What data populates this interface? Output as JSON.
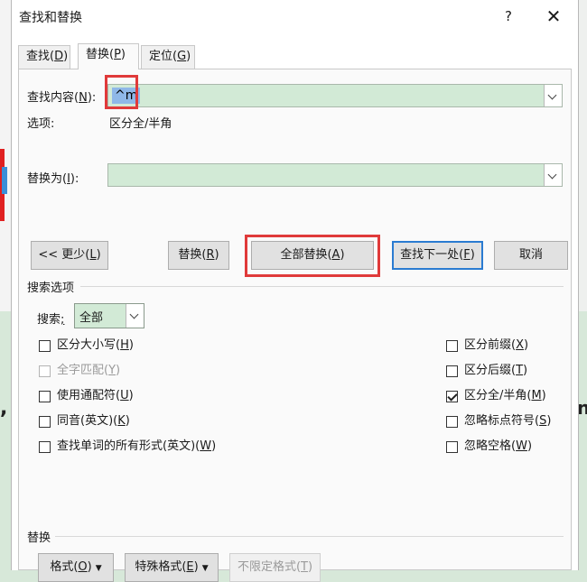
{
  "window": {
    "title": "查找和替换",
    "help_glyph": "?",
    "close_glyph": "✕"
  },
  "tabs": [
    {
      "pre": "查找(",
      "key": "D",
      "post": ")"
    },
    {
      "pre": "替换(",
      "key": "P",
      "post": ")"
    },
    {
      "pre": "定位(",
      "key": "G",
      "post": ")"
    }
  ],
  "find": {
    "label_pre": "查找内容(",
    "label_key": "N",
    "label_post": "):",
    "value": "^m"
  },
  "options": {
    "label": "选项:",
    "value": "区分全/半角"
  },
  "replace": {
    "label_pre": "替换为(",
    "label_key": "I",
    "label_post": "):",
    "value": ""
  },
  "buttons": {
    "less": {
      "pre": "<< 更少(",
      "key": "L",
      "post": ")"
    },
    "replace": {
      "pre": "替换(",
      "key": "R",
      "post": ")"
    },
    "replace_all": {
      "pre": "全部替换(",
      "key": "A",
      "post": ")"
    },
    "find_next": {
      "pre": "查找下一处(",
      "key": "F",
      "post": ")"
    },
    "cancel": "取消"
  },
  "search_options": {
    "heading": "搜索选项",
    "search_label_pre": "搜索",
    "search_label_key": ";",
    "search_value": "全部",
    "left": [
      {
        "text_pre": "区分大小写(",
        "key": "H",
        "text_post": ")",
        "checked": false,
        "disabled": false
      },
      {
        "text_pre": "全字匹配(",
        "key": "Y",
        "text_post": ")",
        "checked": false,
        "disabled": true
      },
      {
        "text_pre": "使用通配符(",
        "key": "U",
        "text_post": ")",
        "checked": false,
        "disabled": false
      },
      {
        "text_pre": "同音(英文)(",
        "key": "K",
        "text_post": ")",
        "checked": false,
        "disabled": false
      },
      {
        "text_pre": "查找单词的所有形式(英文)(",
        "key": "W",
        "text_post": ")",
        "checked": false,
        "disabled": false
      }
    ],
    "right": [
      {
        "text_pre": "区分前缀(",
        "key": "X",
        "text_post": ")",
        "checked": false
      },
      {
        "text_pre": "区分后缀(",
        "key": "T",
        "text_post": ")",
        "checked": false
      },
      {
        "text_pre": "区分全/半角(",
        "key": "M",
        "text_post": ")",
        "checked": true
      },
      {
        "text_pre": "忽略标点符号(",
        "key": "S",
        "text_post": ")",
        "checked": false
      },
      {
        "text_pre": "忽略空格(",
        "key": "W",
        "text_post": ")",
        "checked": false
      }
    ]
  },
  "replace_section": {
    "heading": "替换",
    "format": {
      "pre": "格式(",
      "key": "O",
      "post": ")"
    },
    "special": {
      "pre": "特殊格式(",
      "key": "E",
      "post": ")"
    },
    "no_format": {
      "pre": "不限定格式(",
      "key": "T",
      "post": ")"
    }
  },
  "colors": {
    "field_green": "#d2ead6",
    "highlight_red": "#e03a3a",
    "accent_blue": "#2a7bd1",
    "selection_blue": "#8fb8e8"
  }
}
